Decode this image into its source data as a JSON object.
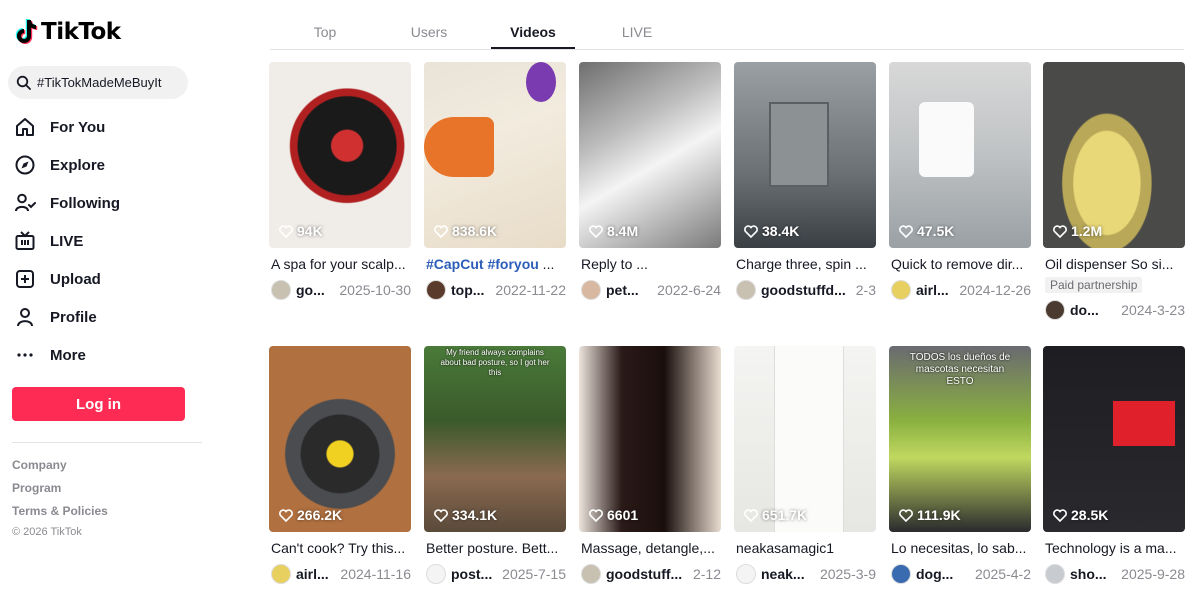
{
  "app": {
    "name": "TikTok"
  },
  "search": {
    "value": "#TikTokMadeMeBuyIt"
  },
  "nav": {
    "items": [
      {
        "label": "For You",
        "icon": "home-icon"
      },
      {
        "label": "Explore",
        "icon": "compass-icon"
      },
      {
        "label": "Following",
        "icon": "user-follow-icon"
      },
      {
        "label": "LIVE",
        "icon": "live-tv-icon"
      },
      {
        "label": "Upload",
        "icon": "plus-square-icon"
      },
      {
        "label": "Profile",
        "icon": "person-icon"
      },
      {
        "label": "More",
        "icon": "more-dots-icon"
      }
    ]
  },
  "login": {
    "label": "Log in"
  },
  "footer": {
    "company": "Company",
    "program": "Program",
    "terms": "Terms & Policies",
    "copyright": "© 2026 TikTok"
  },
  "tabs": [
    {
      "label": "Top",
      "active": false
    },
    {
      "label": "Users",
      "active": false
    },
    {
      "label": "Videos",
      "active": true
    },
    {
      "label": "LIVE",
      "active": false
    }
  ],
  "colors": {
    "brand": "#fe2c55",
    "hashtag": "#2b5db9",
    "muted": "#8a8b91"
  },
  "videos": [
    {
      "likes": "94K",
      "caption": "A spa for your scalp...",
      "user": "go...",
      "date": "2025-10-30"
    },
    {
      "likes": "838.6K",
      "caption_tag1": "#CapCut",
      "caption_tag2": "#foryou",
      "caption_rest": " ...",
      "user": "top...",
      "date": "2022-11-22"
    },
    {
      "likes": "8.4M",
      "caption": "Reply to ...",
      "user": "pet...",
      "date": "2022-6-24"
    },
    {
      "likes": "38.4K",
      "caption": "Charge three, spin ...",
      "user": "goodstuffd...",
      "date": "2-3"
    },
    {
      "likes": "47.5K",
      "caption": "Quick to remove dir...",
      "user": "airl...",
      "date": "2024-12-26"
    },
    {
      "likes": "1.2M",
      "caption": "Oil dispenser So si...",
      "partner": "Paid partnership",
      "user": "do...",
      "date": "2024-3-23"
    },
    {
      "likes": "266.2K",
      "caption": "Can't cook? Try this...",
      "user": "airl...",
      "date": "2024-11-16"
    },
    {
      "likes": "334.1K",
      "caption": "Better posture. Bett...",
      "user": "post...",
      "date": "2025-7-15",
      "overlay": "My friend always complains about bad posture, so I got her this"
    },
    {
      "likes": "6601",
      "caption": "Massage, detangle,...",
      "user": "goodstuff...",
      "date": "2-12"
    },
    {
      "likes": "651.7K",
      "caption": "neakasamagic1",
      "user": "neak...",
      "date": "2025-3-9"
    },
    {
      "likes": "111.9K",
      "caption": "Lo necesitas, lo sab...",
      "user": "dog...",
      "date": "2025-4-2",
      "overlay": "TODOS los dueños de mascotas necesitan ESTO"
    },
    {
      "likes": "28.5K",
      "caption": "Technology is a ma...",
      "user": "sho...",
      "date": "2025-9-28"
    }
  ]
}
